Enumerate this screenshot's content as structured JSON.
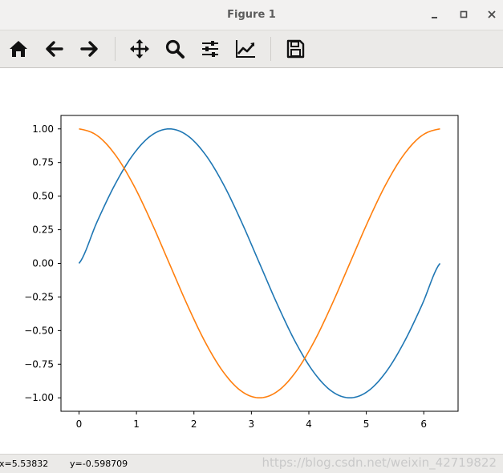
{
  "window": {
    "title": "Figure 1"
  },
  "toolbar": {
    "buttons": [
      {
        "icon": "home-icon",
        "name": "home-button"
      },
      {
        "icon": "back-arrow-icon",
        "name": "back-button"
      },
      {
        "icon": "forward-arrow-icon",
        "name": "forward-button"
      },
      {
        "icon": "pan-move-icon",
        "name": "pan-button"
      },
      {
        "icon": "zoom-magnifier-icon",
        "name": "zoom-button"
      },
      {
        "icon": "subplots-sliders-icon",
        "name": "configure-subplots-button"
      },
      {
        "icon": "axes-line-chart-icon",
        "name": "edit-axes-button"
      },
      {
        "icon": "save-floppy-icon",
        "name": "save-button"
      }
    ]
  },
  "status": {
    "x_readout": "x=5.53832",
    "y_readout": "y=-0.598709",
    "watermark": "https://blog.csdn.net/weixin_42719822"
  },
  "chart_data": {
    "type": "line",
    "title": "",
    "xlabel": "",
    "ylabel": "",
    "xlim": [
      -0.314,
      6.597
    ],
    "ylim": [
      -1.1,
      1.1
    ],
    "xticks": [
      "0",
      "1",
      "2",
      "3",
      "4",
      "5",
      "6"
    ],
    "yticks": [
      "1.00",
      "0.75",
      "0.50",
      "0.25",
      "0.00",
      "−0.25",
      "−0.50",
      "−0.75",
      "−1.00"
    ],
    "ytick_values": [
      1.0,
      0.75,
      0.5,
      0.25,
      0.0,
      -0.25,
      -0.5,
      -0.75,
      -1.0
    ],
    "x": [
      0,
      0.3142,
      0.6283,
      0.9425,
      1.2566,
      1.5708,
      1.885,
      2.1991,
      2.5133,
      2.8274,
      3.1416,
      3.4558,
      3.7699,
      4.0841,
      4.3982,
      4.7124,
      5.0265,
      5.3407,
      5.6549,
      5.969,
      6.2832
    ],
    "series": [
      {
        "color": "#1f77b4",
        "values": [
          0,
          0.309,
          0.588,
          0.809,
          0.951,
          1,
          0.951,
          0.809,
          0.588,
          0.309,
          0,
          -0.309,
          -0.588,
          -0.809,
          -0.951,
          -1,
          -0.951,
          -0.809,
          -0.588,
          -0.309,
          0
        ]
      },
      {
        "color": "#ff7f0e",
        "values": [
          1,
          0.951,
          0.809,
          0.588,
          0.309,
          0,
          -0.309,
          -0.588,
          -0.809,
          -0.951,
          -1,
          -0.951,
          -0.809,
          -0.588,
          -0.309,
          0,
          0.309,
          0.588,
          0.809,
          0.951,
          1
        ]
      }
    ],
    "grid": false,
    "legend": "none"
  }
}
